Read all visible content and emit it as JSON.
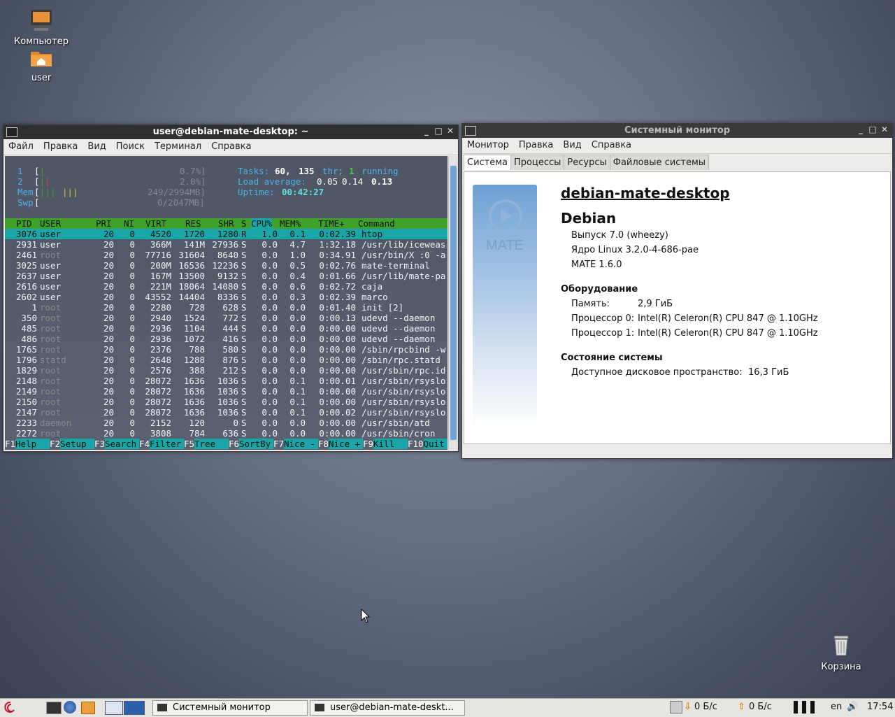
{
  "desktop": {
    "icons": [
      {
        "label": "Компьютер",
        "icon": "computer-icon"
      },
      {
        "label": "user",
        "icon": "home-folder-icon"
      },
      {
        "label": "Корзина",
        "icon": "trash-icon"
      }
    ]
  },
  "terminal": {
    "title": "user@debian-mate-desktop: ~",
    "menu": [
      "Файл",
      "Правка",
      "Вид",
      "Поиск",
      "Терминал",
      "Справка"
    ],
    "htop": {
      "cpu1_label": "1",
      "cpu1_pct": "0.7%]",
      "cpu2_label": "2",
      "cpu2_pct": "2.0%]",
      "mem_label": "Mem",
      "mem_val": "249/2994MB]",
      "swp_label": "Swp",
      "swp_val": "0/2047MB]",
      "tasks_label": "Tasks:",
      "tasks": "60,",
      "thr": "135",
      "thr_label": "thr;",
      "running": "1",
      "running_label": "running",
      "load_label": "Load average:",
      "load1": "0.05",
      "load5": "0.14",
      "load15": "0.13",
      "uptime_label": "Uptime:",
      "uptime": "00:42:27",
      "columns": [
        "PID",
        "USER",
        "PRI",
        "NI",
        "VIRT",
        "RES",
        "SHR",
        "S",
        "CPU%",
        "MEM%",
        "TIME+",
        "Command"
      ],
      "rows": [
        [
          "3076",
          "user",
          "20",
          "0",
          "4520",
          "1720",
          "1280",
          "R",
          "1.0",
          "0.1",
          "0:02.39",
          "htop"
        ],
        [
          "2931",
          "user",
          "20",
          "0",
          "366M",
          "141M",
          "27936",
          "S",
          "0.0",
          "4.7",
          "1:32.18",
          "/usr/lib/iceweas"
        ],
        [
          "2461",
          "root",
          "20",
          "0",
          "77716",
          "31604",
          "8640",
          "S",
          "0.0",
          "1.0",
          "0:34.91",
          "/usr/bin/X :0 -a"
        ],
        [
          "3025",
          "user",
          "20",
          "0",
          "200M",
          "16536",
          "12236",
          "S",
          "0.0",
          "0.5",
          "0:02.76",
          "mate-terminal"
        ],
        [
          "2637",
          "user",
          "20",
          "0",
          "167M",
          "13500",
          "9132",
          "S",
          "0.0",
          "0.4",
          "0:01.66",
          "/usr/lib/mate-pa"
        ],
        [
          "2616",
          "user",
          "20",
          "0",
          "221M",
          "18064",
          "14080",
          "S",
          "0.0",
          "0.6",
          "0:02.72",
          "caja"
        ],
        [
          "2602",
          "user",
          "20",
          "0",
          "43552",
          "14404",
          "8336",
          "S",
          "0.0",
          "0.3",
          "0:02.39",
          "marco"
        ],
        [
          "1",
          "root",
          "20",
          "0",
          "2280",
          "728",
          "628",
          "S",
          "0.0",
          "0.0",
          "0:01.40",
          "init [2]"
        ],
        [
          "350",
          "root",
          "20",
          "0",
          "2940",
          "1524",
          "772",
          "S",
          "0.0",
          "0.0",
          "0:00.13",
          "udevd --daemon"
        ],
        [
          "485",
          "root",
          "20",
          "0",
          "2936",
          "1104",
          "444",
          "S",
          "0.0",
          "0.0",
          "0:00.00",
          "udevd --daemon"
        ],
        [
          "486",
          "root",
          "20",
          "0",
          "2936",
          "1072",
          "416",
          "S",
          "0.0",
          "0.0",
          "0:00.00",
          "udevd --daemon"
        ],
        [
          "1765",
          "root",
          "20",
          "0",
          "2376",
          "788",
          "580",
          "S",
          "0.0",
          "0.0",
          "0:00.00",
          "/sbin/rpcbind -w"
        ],
        [
          "1796",
          "statd",
          "20",
          "0",
          "2648",
          "1288",
          "876",
          "S",
          "0.0",
          "0.0",
          "0:00.00",
          "/sbin/rpc.statd"
        ],
        [
          "1829",
          "root",
          "20",
          "0",
          "2576",
          "388",
          "212",
          "S",
          "0.0",
          "0.0",
          "0:00.00",
          "/usr/sbin/rpc.id"
        ],
        [
          "2148",
          "root",
          "20",
          "0",
          "28072",
          "1636",
          "1036",
          "S",
          "0.0",
          "0.1",
          "0:00.01",
          "/usr/sbin/rsyslo"
        ],
        [
          "2149",
          "root",
          "20",
          "0",
          "28072",
          "1636",
          "1036",
          "S",
          "0.0",
          "0.1",
          "0:00.00",
          "/usr/sbin/rsyslo"
        ],
        [
          "2150",
          "root",
          "20",
          "0",
          "28072",
          "1636",
          "1036",
          "S",
          "0.0",
          "0.1",
          "0:00.00",
          "/usr/sbin/rsyslo"
        ],
        [
          "2147",
          "root",
          "20",
          "0",
          "28072",
          "1636",
          "1036",
          "S",
          "0.0",
          "0.1",
          "0:00.02",
          "/usr/sbin/rsyslo"
        ],
        [
          "2233",
          "daemon",
          "20",
          "0",
          "2152",
          "120",
          "0",
          "S",
          "0.0",
          "0.0",
          "0:00.00",
          "/usr/sbin/atd"
        ],
        [
          "2272",
          "root",
          "20",
          "0",
          "3808",
          "784",
          "636",
          "S",
          "0.0",
          "0.0",
          "0:00.00",
          "/usr/sbin/cron"
        ]
      ],
      "fkeys": [
        [
          "F1",
          "Help"
        ],
        [
          "F2",
          "Setup"
        ],
        [
          "F3",
          "Search"
        ],
        [
          "F4",
          "Filter"
        ],
        [
          "F5",
          "Tree"
        ],
        [
          "F6",
          "SortBy"
        ],
        [
          "F7",
          "Nice -"
        ],
        [
          "F8",
          "Nice +"
        ],
        [
          "F9",
          "Kill"
        ],
        [
          "F10",
          "Quit"
        ]
      ]
    }
  },
  "sysmon": {
    "title": "Системный монитор",
    "menu": [
      "Монитор",
      "Правка",
      "Вид",
      "Справка"
    ],
    "tabs": [
      "Система",
      "Процессы",
      "Ресурсы",
      "Файловые системы"
    ],
    "logo_text": "MATE",
    "hostname": "debian-mate-desktop",
    "distro": "Debian",
    "release": "Выпуск 7.0 (wheezy)",
    "kernel": "Ядро Linux 3.2.0-4-686-pae",
    "mate_version": "MATE 1.6.0",
    "hardware_heading": "Оборудование",
    "memory_label": "Память:",
    "memory_value": "2,9 ГиБ",
    "cpu0_label": "Процессор 0:",
    "cpu0_value": "Intel(R) Celeron(R) CPU 847 @ 1.10GHz",
    "cpu1_label": "Процессор 1:",
    "cpu1_value": "Intel(R) Celeron(R) CPU 847 @ 1.10GHz",
    "status_heading": "Состояние системы",
    "disk_label": "Доступное дисковое пространство:",
    "disk_value": "16,3 ГиБ"
  },
  "taskbar": {
    "tasks": [
      "Системный монитор",
      "user@debian-mate-deskt..."
    ],
    "net_down": "0 Б/с",
    "net_up": "0 Б/с",
    "keyboard_layout": "en",
    "clock": "17:54"
  }
}
